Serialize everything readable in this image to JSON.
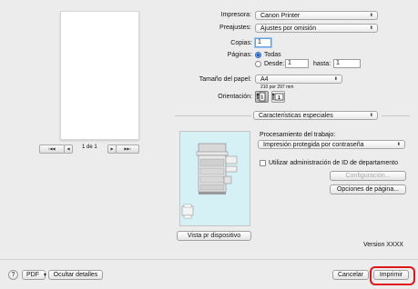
{
  "printer": {
    "label": "Impresora:",
    "value": "Canon Printer"
  },
  "presets": {
    "label": "Preajustes:",
    "value": "Ajustes por omisión"
  },
  "copies": {
    "label": "Copias:",
    "value": "1"
  },
  "pages": {
    "label": "Páginas:",
    "all_label": "Todas",
    "from_label": "Desde:",
    "from_value": "1",
    "to_label": "hasta:",
    "to_value": "1"
  },
  "paper_size": {
    "label": "Tamaño del papel:",
    "value": "A4",
    "dimensions": "210 por 297 mm"
  },
  "orientation": {
    "label": "Orientación:"
  },
  "section_popup": {
    "value": "Características especiales"
  },
  "job": {
    "label": "Procesamiento del trabajo:",
    "value": "Impresión protegida por contraseña"
  },
  "dept_id": {
    "label": "Utilizar administración de ID de departamento"
  },
  "config_button": "Configuración...",
  "page_options_button": "Opciones de página...",
  "printer_view_button": "Vista pr dispositivo",
  "version": "Version XXXX",
  "pager": {
    "first": "I◀◀",
    "prev": "◀",
    "text": "1 de 1",
    "next": "▶",
    "last": "▶▶I"
  },
  "footer": {
    "help": "?",
    "pdf": "PDF",
    "hide_details": "Ocultar detalles",
    "cancel": "Cancelar",
    "print": "Imprimir"
  },
  "colors": {
    "highlight": "#e0161b",
    "printer_bg": "#d6f1f6",
    "accent": "#2e69c2"
  }
}
